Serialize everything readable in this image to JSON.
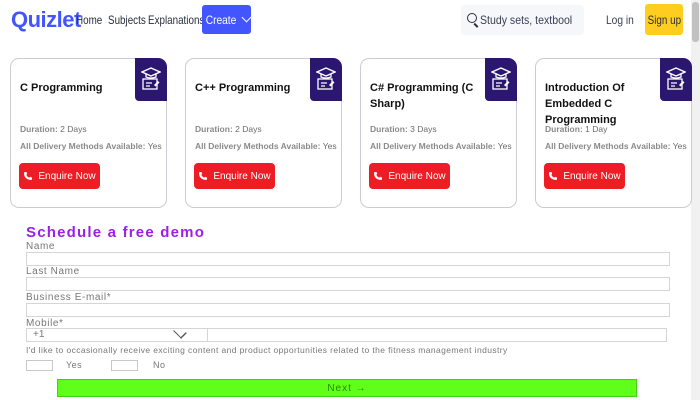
{
  "nav": {
    "logo": "Quizlet",
    "links": [
      "Home",
      "Subjects",
      "Explanations"
    ],
    "create_label": "Create",
    "search_placeholder": "Study sets, textbooks, ...",
    "login_label": "Log in",
    "signup_label": "Sign up"
  },
  "cards": [
    {
      "title": "C Programming",
      "duration_label": "Duration:",
      "duration": "2 Days",
      "delivery_label": "All Delivery Methods Available:",
      "delivery": "Yes",
      "button": "Enquire Now"
    },
    {
      "title": "C++ Programming",
      "duration_label": "Duration:",
      "duration": "2 Days",
      "delivery_label": "All Delivery Methods Available:",
      "delivery": "Yes",
      "button": "Enquire Now"
    },
    {
      "title": "C# Programming (C Sharp)",
      "duration_label": "Duration:",
      "duration": "3 Days",
      "delivery_label": "All Delivery Methods Available:",
      "delivery": "Yes",
      "button": "Enquire Now"
    },
    {
      "title": "Introduction Of Embedded C Programming",
      "duration_label": "Duration:",
      "duration": "1 Day",
      "delivery_label": "All Delivery Methods Available:",
      "delivery": "Yes",
      "button": "Enquire Now"
    }
  ],
  "form": {
    "heading": "Schedule a free demo",
    "name_label": "Name",
    "last_name_label": "Last Name",
    "email_label": "Business E-mail*",
    "mobile_label": "Mobile*",
    "country_code": "+1",
    "consent": "I'd like to occasionally receive exciting content and product opportunities related to the fitness management industry",
    "yes_label": "Yes",
    "no_label": "No",
    "next_label": "Next →"
  },
  "colors": {
    "brand": "#4255ff",
    "signup": "#ffcd1f",
    "badge": "#2b1670",
    "enquire": "#ee1c25",
    "heading": "#9b1fe8",
    "next": "#5fff1a"
  }
}
